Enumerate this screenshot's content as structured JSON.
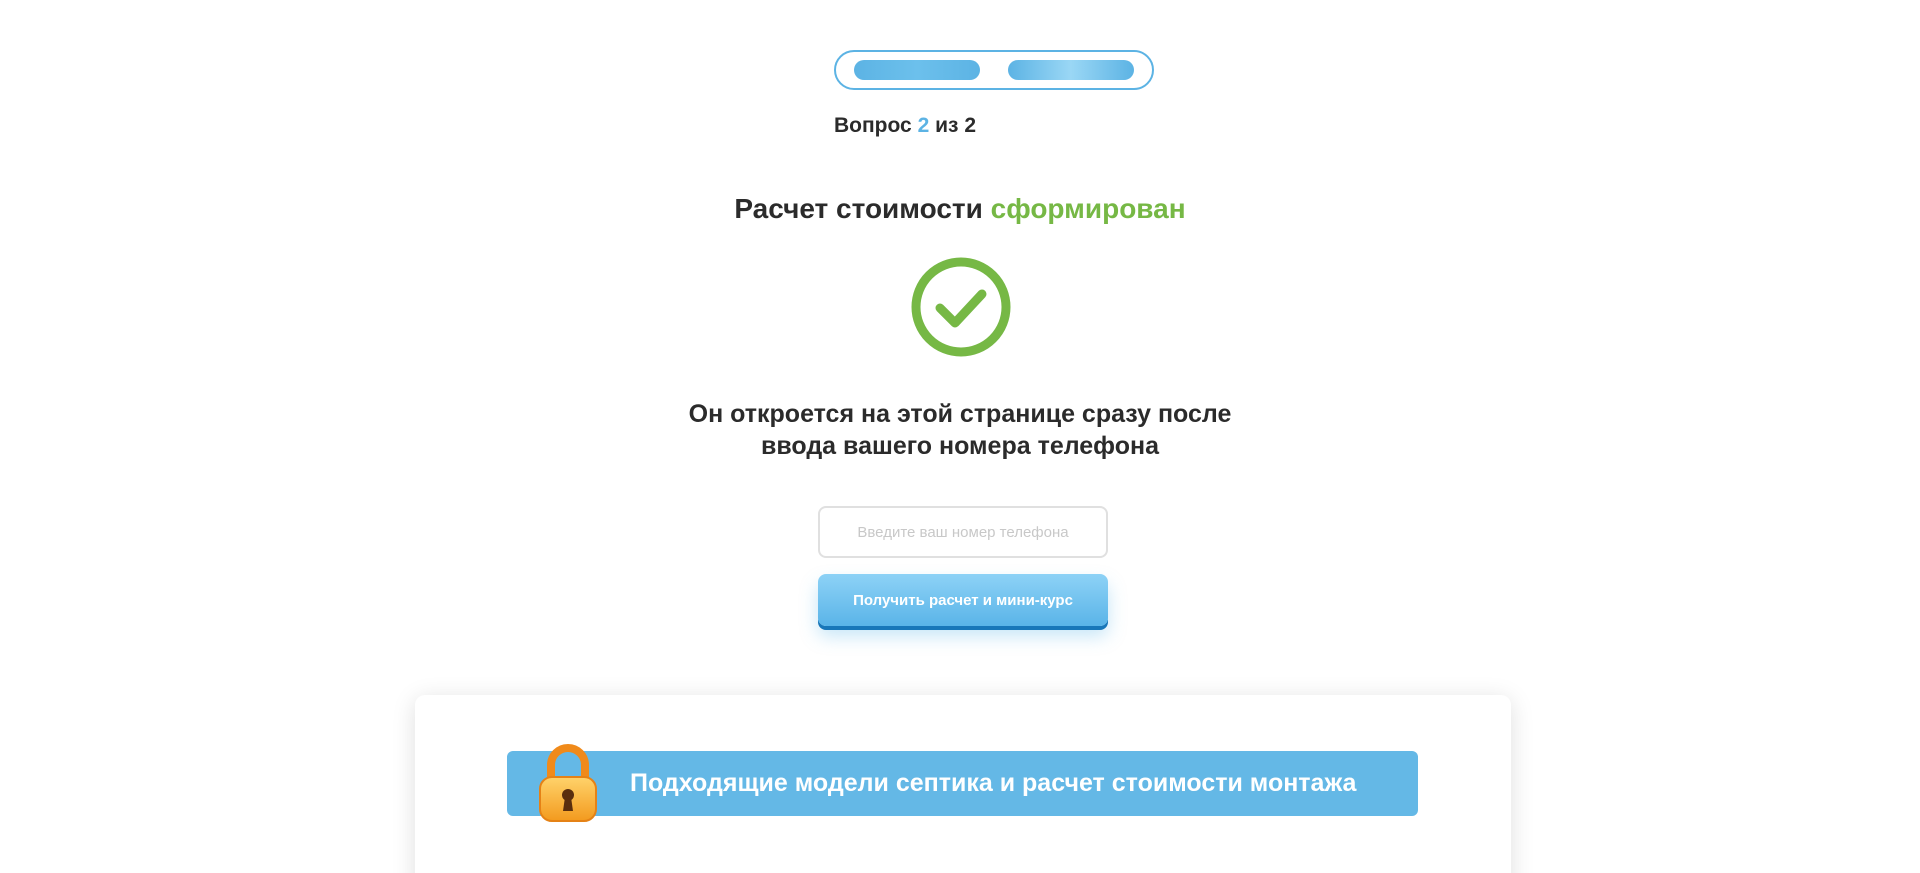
{
  "progress": {
    "current": 2,
    "total": 2
  },
  "step": {
    "prefix": "Вопрос",
    "current": "2",
    "middle": "из",
    "total": "2"
  },
  "result": {
    "title_main": "Расчет стоимости",
    "title_accent": "сформирован",
    "description_line1": "Он откроется на этой странице сразу после",
    "description_line2": "ввода вашего номера телефона"
  },
  "form": {
    "phone_placeholder": "Введите ваш номер телефона",
    "phone_value": "",
    "submit_label": "Получить расчет и мини-курс"
  },
  "locked_section": {
    "banner_label": "Подходящие модели септика и расчет стоимости монтажа"
  },
  "icons": {
    "success": "check-circle-icon",
    "locked": "padlock-icon"
  },
  "colors": {
    "accent_blue": "#5cb3e4",
    "success_green": "#76b845",
    "banner_blue": "#64b8e6",
    "lock_orange": "#f39a1e"
  }
}
